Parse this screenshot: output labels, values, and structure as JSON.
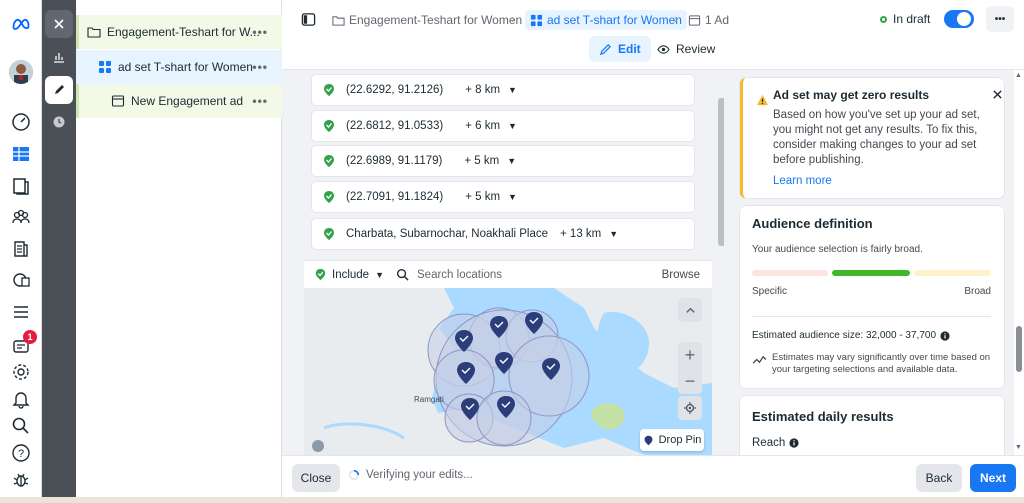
{
  "nav": {
    "notifications_count": "1"
  },
  "tree": {
    "campaign": "Engagement-Teshart for W...",
    "adset": "ad set T-shart for Women",
    "ad": "New Engagement ad",
    "more": "•••"
  },
  "breadcrumb": {
    "campaign": "Engagement-Teshart for Women",
    "adset": "ad set T-shart for Women",
    "ads": "1 Ad"
  },
  "header": {
    "status": "In draft",
    "more": "•••",
    "edit_label": "Edit",
    "review_label": "Review"
  },
  "locations": [
    {
      "name": "(22.6292, 91.2126)",
      "radius": "+ 8 km"
    },
    {
      "name": "(22.6812, 91.0533)",
      "radius": "+ 6 km"
    },
    {
      "name": "(22.6989, 91.1179)",
      "radius": "+ 5 km"
    },
    {
      "name": "(22.7091, 91.1824)",
      "radius": "+ 5 km"
    },
    {
      "name": "Charbata, Subarnochar, Noakhali Place",
      "radius": "+ 13 km"
    }
  ],
  "location_search": {
    "include_label": "Include",
    "placeholder": "Search locations",
    "browse_label": "Browse"
  },
  "map": {
    "place_label": "Ramgati",
    "drop_pin_label": "Drop Pin"
  },
  "warning": {
    "title": "Ad set may get zero results",
    "body": "Based on how you've set up your ad set, you might not get any results. To fix this, consider making changes to your ad set before publishing.",
    "link": "Learn more"
  },
  "audience": {
    "title": "Audience definition",
    "subtitle": "Your audience selection is fairly broad.",
    "specific_label": "Specific",
    "broad_label": "Broad",
    "size_text": "Estimated audience size: 32,000 - 37,700",
    "note": "Estimates may vary significantly over time based on your targeting selections and available data."
  },
  "daily": {
    "title": "Estimated daily results",
    "reach_label": "Reach"
  },
  "footer": {
    "close_label": "Close",
    "verifying_text": "Verifying your edits...",
    "back_label": "Back",
    "next_label": "Next"
  },
  "colors": {
    "accent": "#1877f2",
    "warning": "#f7b928",
    "pin": "#2c3e7a",
    "check": "#31a24c"
  }
}
